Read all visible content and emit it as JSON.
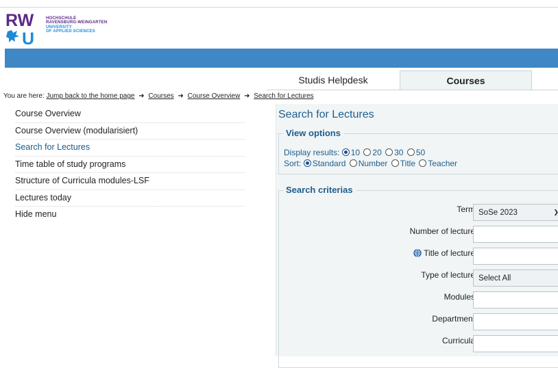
{
  "logo": {
    "mark": "RWU",
    "lines": [
      "HOCHSCHULE",
      "RAVENSBURG-WEINGARTEN",
      "UNIVERSITY",
      "OF APPLIED SCIENCES"
    ]
  },
  "tabs": [
    {
      "label": "Studis Helpdesk"
    },
    {
      "label": "Courses"
    }
  ],
  "breadcrumb": {
    "prefix": "You are here:",
    "items": [
      "Jump back to the home page",
      "Courses",
      "Course Overview",
      "Search for Lectures"
    ]
  },
  "sidebar": {
    "items": [
      {
        "label": "Course Overview"
      },
      {
        "label": "Course Overview (modularisiert)"
      },
      {
        "label": "Search for Lectures"
      },
      {
        "label": "Time table of study programs"
      },
      {
        "label": "Structure of Curricula modules-LSF"
      },
      {
        "label": "Lectures today"
      },
      {
        "label": "Hide menu"
      }
    ]
  },
  "main": {
    "title": "Search for Lectures",
    "view_options": {
      "legend": "View options",
      "display_label": "Display results:",
      "display_options": [
        "10",
        "20",
        "30",
        "50"
      ],
      "display_selected": "10",
      "sort_label": "Sort:",
      "sort_options": [
        "Standard",
        "Number",
        "Title",
        "Teacher"
      ],
      "sort_selected": "Standard"
    },
    "criteria": {
      "legend": "Search criterias",
      "term_label": "Term",
      "term_value": "SoSe 2023",
      "number_label": "Number of lecture",
      "title_label": "Title of lecture",
      "type_label": "Type of lecture",
      "type_value": "Select All",
      "modules_label": "Modules",
      "department_label": "Department",
      "curricula_label": "Curricula"
    }
  },
  "colors": {
    "brand_purple": "#5b2a86",
    "brand_blue": "#1e8bd6",
    "header_bar": "#3f88c5",
    "link_blue": "#1f5d8c"
  }
}
